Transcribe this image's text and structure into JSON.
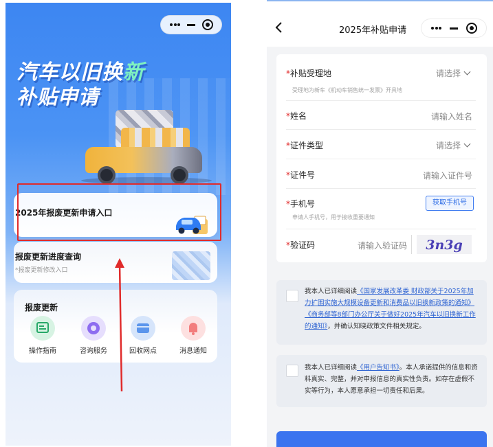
{
  "left": {
    "hero_line1_a": "汽车以旧换",
    "hero_line1_b": "新",
    "hero_line2": "补贴申请",
    "apply_entry_title": "2025年报废更新申请入口",
    "progress_query": {
      "title": "报废更新进度查询",
      "subtitle": "*报废更新修改入口"
    },
    "services": {
      "title": "报废更新",
      "items": [
        {
          "label": "操作指南",
          "icon": "guide-icon"
        },
        {
          "label": "咨询服务",
          "icon": "consult-icon"
        },
        {
          "label": "回收网点",
          "icon": "recycle-point-icon"
        },
        {
          "label": "消息通知",
          "icon": "message-icon"
        }
      ]
    },
    "highlight_color": "#e02b2b"
  },
  "right": {
    "nav_title": "2025年补贴申请",
    "form": {
      "required_mark": "*",
      "region": {
        "label": "补贴受理地",
        "value": "请选择",
        "hint": "受理地为新车《机动车销售统一发票》开具地"
      },
      "name": {
        "label": "姓名",
        "placeholder": "请输入姓名"
      },
      "id_type": {
        "label": "证件类型",
        "value": "请选择"
      },
      "id_number": {
        "label": "证件号",
        "placeholder": "请输入证件号"
      },
      "phone": {
        "label": "手机号",
        "hint": "申请人手机号，用于接收重要通知",
        "button": "获取手机号"
      },
      "captcha": {
        "label": "验证码",
        "placeholder": "请输入验证码",
        "code": "3n3g"
      }
    },
    "notice1": {
      "pre": "我本人已详细阅读",
      "link1": "《国家发展改革委 财政部关于2025年加力扩围实施大规模设备更新和消费品以旧换新政策的通知》",
      "link2": "《商务部等8部门办公厅关于做好2025年汽车以旧换新工作的通知》",
      "post": "，并确认知晓政策文件相关规定。"
    },
    "notice2": {
      "pre": "我本人已详细阅读",
      "link": "《用户告知书》",
      "post": "。本人承诺提供的信息和资料真实、完整，并对申报信息的真实性负责。如存在虚假不实等行为，本人愿意承担一切责任和后果。"
    },
    "accent_color": "#3b74ef"
  }
}
